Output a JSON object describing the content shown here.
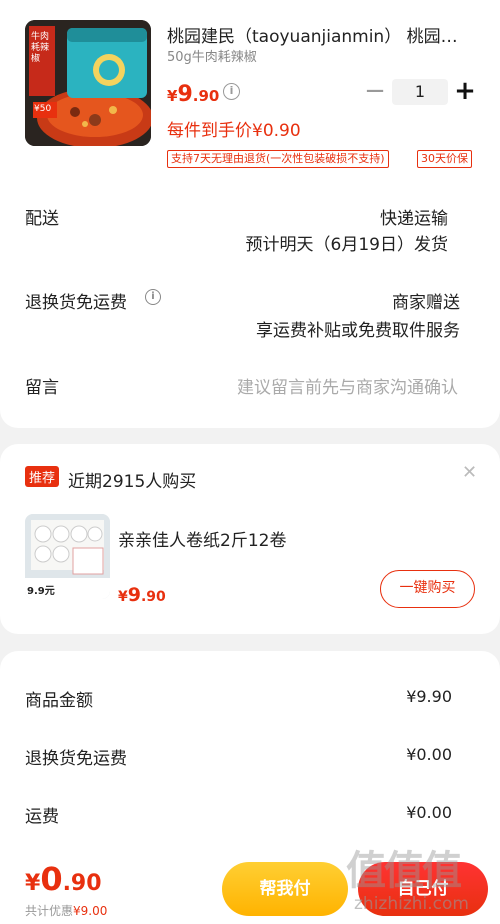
{
  "product": {
    "title": "桃园建民（taoyuanjianmin） 桃园建民牛肉耗辣椒",
    "spec": "50g牛肉耗辣椒",
    "price_currency": "¥",
    "price_int": "9",
    "price_dec": ".90",
    "unit_price": "每件到手价¥0.90",
    "qty": "1",
    "tags": [
      "支持7天无理由退货(一次性包装破损不支持)",
      "30天价保"
    ],
    "image_label": "牛肉耗辣椒",
    "image_badge": "¥50"
  },
  "delivery": {
    "label": "配送",
    "method": "快递运输",
    "eta": "预计明天（6月19日）发货"
  },
  "return_shipping": {
    "label": "退换货免运费",
    "value": "商家赠送",
    "desc": "享运费补贴或免费取件服务"
  },
  "message": {
    "label": "留言",
    "placeholder": "建议留言前先与商家沟通确认"
  },
  "recommend": {
    "badge": "推荐",
    "title": "近期2915人购买",
    "item_name": "亲亲佳人卷纸2斤12卷",
    "price_currency": "¥",
    "price_int": "9",
    "price_dec": ".90",
    "image_price": "9.9元",
    "buy_label": "一键购买"
  },
  "summary": [
    {
      "label": "商品金额",
      "value": "¥9.90"
    },
    {
      "label": "退换货免运费",
      "value": "¥0.00"
    },
    {
      "label": "运费",
      "value": "¥0.00"
    }
  ],
  "footer": {
    "total_currency": "¥",
    "total_int": "0",
    "total_dec": ".90",
    "save_label": "共计优惠",
    "save_value": "¥9.00",
    "help_label": "帮我付",
    "pay_label": "自己付"
  },
  "watermark": {
    "main": "值值值",
    "sub": "zhizhizhi.com"
  },
  "colors": {
    "accent": "#e8300f",
    "help_button": "#ffb300"
  }
}
